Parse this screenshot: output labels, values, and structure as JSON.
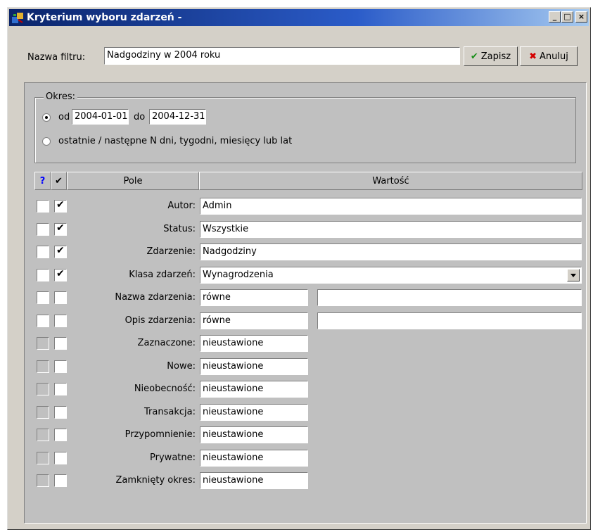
{
  "window": {
    "title": "Kryterium wyboru zdarzeń -",
    "minimize": "_",
    "maximize": "□",
    "close": "×"
  },
  "filter": {
    "label": "Nazwa filtru:",
    "value": "Nadgodziny w 2004 roku",
    "save_label": "Zapisz",
    "cancel_label": "Anuluj",
    "save_icon": "check-icon",
    "cancel_icon": "x-icon"
  },
  "period": {
    "legend": "Okres:",
    "option1_from_label": "od",
    "from_value": "2004-01-01",
    "option1_to_label": "do",
    "to_value": "2004-12-31",
    "option2_label": "ostatnie / następne N dni, tygodni, miesięcy lub lat"
  },
  "table": {
    "col_q": "?",
    "col_check": "✔",
    "col_field": "Pole",
    "col_value": "Wartość",
    "rows": [
      {
        "label": "Autor:",
        "value": "Admin",
        "checked": true,
        "enabled": true
      },
      {
        "label": "Status:",
        "value": "Wszystkie",
        "checked": true,
        "enabled": true
      },
      {
        "label": "Zdarzenie:",
        "value": "Nadgodziny",
        "checked": true,
        "enabled": true
      },
      {
        "label": "Klasa zdarzeń:",
        "value": "Wynagrodzenia",
        "checked": true,
        "enabled": true
      },
      {
        "label": "Nazwa zdarzenia:",
        "value": "równe",
        "value2": "",
        "checked": false,
        "enabled": true
      },
      {
        "label": "Opis zdarzenia:",
        "value": "równe",
        "value2": "",
        "checked": false,
        "enabled": true
      },
      {
        "label": "Zaznaczone:",
        "value": "nieustawione",
        "checked": false,
        "enabled": false
      },
      {
        "label": "Nowe:",
        "value": "nieustawione",
        "checked": false,
        "enabled": false
      },
      {
        "label": "Nieobecność:",
        "value": "nieustawione",
        "checked": false,
        "enabled": false
      },
      {
        "label": "Transakcja:",
        "value": "nieustawione",
        "checked": false,
        "enabled": false
      },
      {
        "label": "Przypomnienie:",
        "value": "nieustawione",
        "checked": false,
        "enabled": false
      },
      {
        "label": "Prywatne:",
        "value": "nieustawione",
        "checked": false,
        "enabled": false
      },
      {
        "label": "Zamknięty okres:",
        "value": "nieustawione",
        "checked": false,
        "enabled": false
      }
    ]
  },
  "colors": {
    "title_start": "#0a246a",
    "title_end": "#a6caf0",
    "face": "#d4d0c8",
    "save_icon_color": "#1a8f1a",
    "cancel_icon_color": "#d40000",
    "help_color": "#0000ff"
  }
}
